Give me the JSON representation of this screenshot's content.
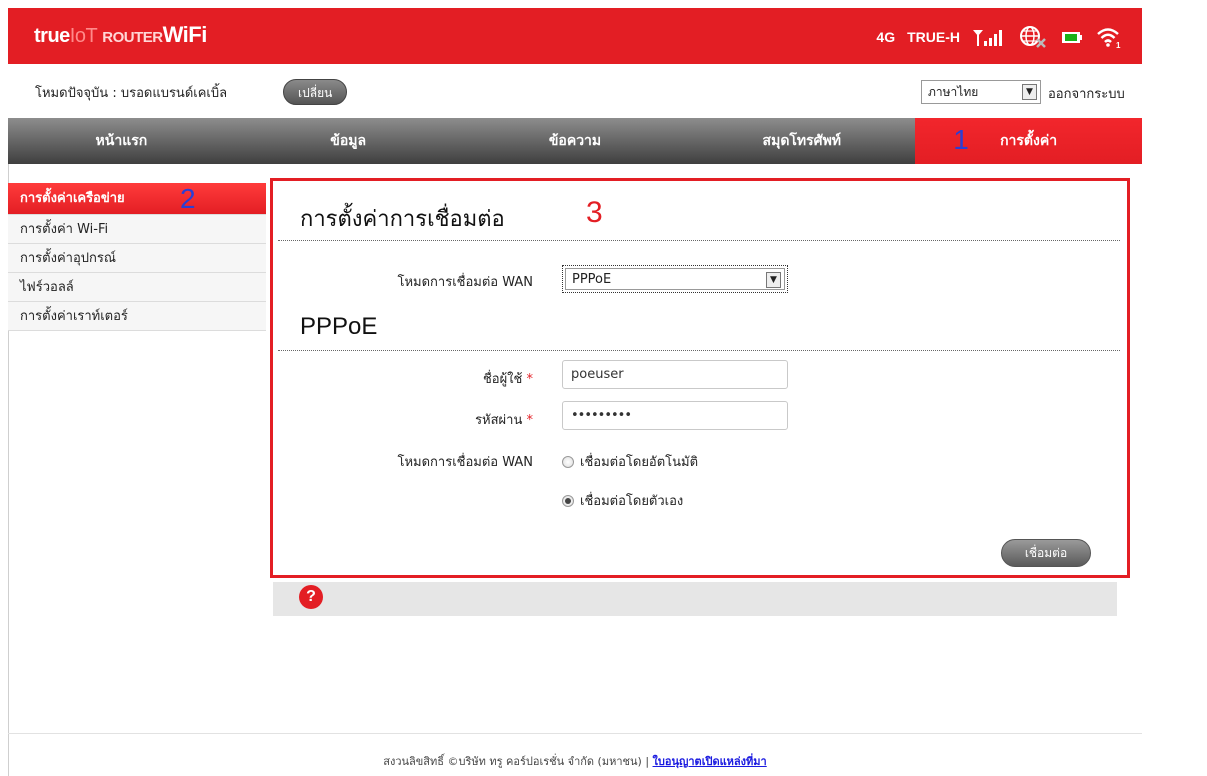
{
  "header": {
    "logo": {
      "part1": "true",
      "part2": "IoT",
      "part3": "ROUTER",
      "part4": "WiFi"
    },
    "network_type": "4G",
    "carrier": "TRUE-H",
    "icons": [
      "signal-icon",
      "globe-disconnected-icon",
      "battery-icon",
      "wifi-icon"
    ],
    "wifi_clients": "1"
  },
  "mode_bar": {
    "mode_label": "โหมดปัจจุบัน : บรอดแบรนด์เคเบิ้ล",
    "change_button": "เปลี่ยน",
    "language": "ภาษาไทย",
    "logout": "ออกจากระบบ"
  },
  "nav": {
    "items": [
      {
        "label": "หน้าแรก"
      },
      {
        "label": "ข้อมูล"
      },
      {
        "label": "ข้อความ"
      },
      {
        "label": "สมุดโทรศัพท์"
      },
      {
        "label": "การตั้งค่า",
        "active": true,
        "marker": "1"
      }
    ]
  },
  "sidebar": {
    "items": [
      {
        "label": "การตั้งค่าเครือข่าย",
        "active": true,
        "marker": "2"
      },
      {
        "label": "การตั้งค่า Wi-Fi"
      },
      {
        "label": "การตั้งค่าอุปกรณ์"
      },
      {
        "label": "ไฟร์วอลล์"
      },
      {
        "label": "การตั้งค่าเราท์เตอร์"
      }
    ]
  },
  "main": {
    "title": "การตั้งค่าการเชื่อมต่อ",
    "marker": "3",
    "wan_mode_label": "โหมดการเชื่อมต่อ WAN",
    "wan_mode_value": "PPPoE",
    "section_title": "PPPoE",
    "username_label": "ชื่อผู้ใช้",
    "username_value": "poeuser",
    "password_label": "รหัสผ่าน",
    "password_value": "•••••••••",
    "required_mark": "*",
    "conn_mode_label": "โหมดการเชื่อมต่อ WAN",
    "radio_auto": "เชื่อมต่อโดยอัตโนมัติ",
    "radio_manual": "เชื่อมต่อโดยตัวเอง",
    "selected_radio": "manual",
    "connect_button": "เชื่อมต่อ"
  },
  "help": {
    "icon": "?"
  },
  "footer": {
    "copyright": "สงวนลิขสิทธิ์ ©บริษัท ทรู คอร์ปอเรชั่น จำกัด (มหาชน)",
    "separator": "|",
    "license_link": "ใบอนุญาตเปิดแหล่งที่มา"
  },
  "colors": {
    "brand_red": "#e31e24",
    "marker_blue": "#2b3fd4",
    "nav_dark": "#3f3f3f"
  }
}
